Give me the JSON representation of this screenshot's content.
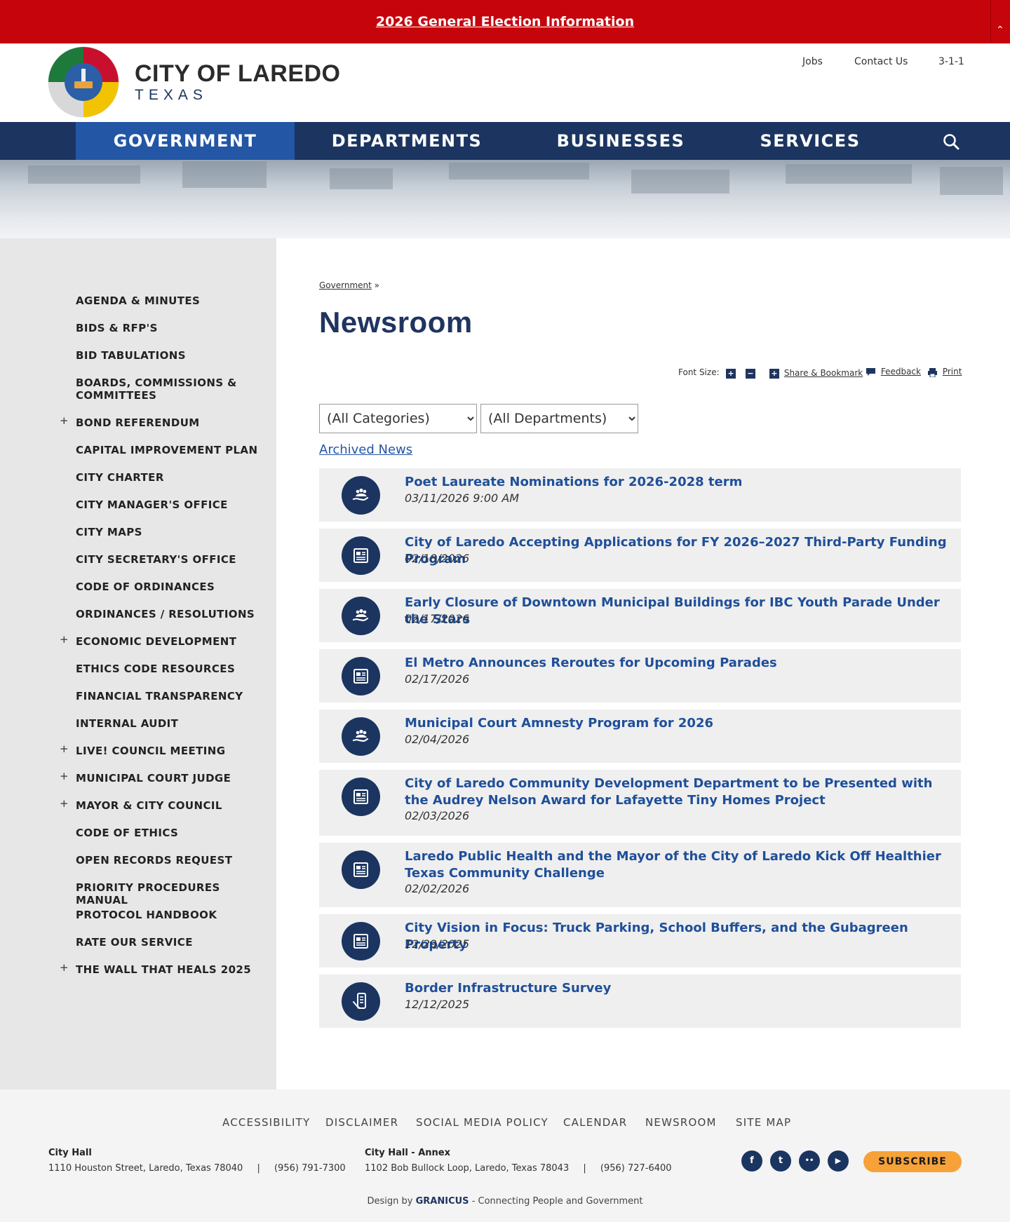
{
  "alert": {
    "text": "2026 General Election Information",
    "top_icon": "double-chevron-up-icon"
  },
  "brand": {
    "title": "CITY OF LAREDO",
    "subtitle": "TEXAS",
    "seal": "city-seal"
  },
  "utility": [
    "Jobs",
    "Contact Us",
    "3-1-1"
  ],
  "nav": {
    "items": [
      "GOVERNMENT",
      "DEPARTMENTS",
      "BUSINESSES",
      "SERVICES"
    ],
    "active": "GOVERNMENT",
    "search_icon": "search-icon"
  },
  "sidebar": {
    "items": [
      {
        "label": "AGENDA & MINUTES",
        "expand": ""
      },
      {
        "label": "BIDS & RFP'S",
        "expand": ""
      },
      {
        "label": "BID TABULATIONS",
        "expand": ""
      },
      {
        "label": "BOARDS, COMMISSIONS & COMMITTEES",
        "expand": ""
      },
      {
        "label": "BOND REFERENDUM",
        "expand": "+"
      },
      {
        "label": "CAPITAL IMPROVEMENT PLAN",
        "expand": ""
      },
      {
        "label": "CITY CHARTER",
        "expand": ""
      },
      {
        "label": "CITY MANAGER'S OFFICE",
        "expand": ""
      },
      {
        "label": "CITY MAPS",
        "expand": ""
      },
      {
        "label": "CITY SECRETARY'S OFFICE",
        "expand": ""
      },
      {
        "label": "CODE OF ORDINANCES",
        "expand": ""
      },
      {
        "label": "ORDINANCES / RESOLUTIONS",
        "expand": ""
      },
      {
        "label": "ECONOMIC DEVELOPMENT",
        "expand": "+"
      },
      {
        "label": "ETHICS CODE RESOURCES",
        "expand": ""
      },
      {
        "label": "FINANCIAL TRANSPARENCY",
        "expand": ""
      },
      {
        "label": "INTERNAL AUDIT",
        "expand": ""
      },
      {
        "label": "LIVE! COUNCIL MEETING",
        "expand": "+"
      },
      {
        "label": "MUNICIPAL COURT JUDGE",
        "expand": "+"
      },
      {
        "label": "MAYOR & CITY COUNCIL",
        "expand": "+"
      },
      {
        "label": "CODE OF ETHICS",
        "expand": ""
      },
      {
        "label": "OPEN RECORDS REQUEST",
        "expand": ""
      },
      {
        "label": "PRIORITY PROCEDURES MANUAL",
        "expand": ""
      },
      {
        "label": "PROTOCOL HANDBOOK",
        "expand": ""
      },
      {
        "label": "RATE OUR SERVICE",
        "expand": ""
      },
      {
        "label": "THE WALL THAT HEALS 2025",
        "expand": "+"
      }
    ]
  },
  "breadcrumb": {
    "link": "Government",
    "sep": "»"
  },
  "page_title": "Newsroom",
  "tools": {
    "font_size_label": "Font Size:",
    "increase": "+",
    "decrease": "−",
    "share_icon": "+",
    "share": "Share & Bookmark",
    "feedback": "Feedback",
    "print": "Print"
  },
  "filters": {
    "categories": "(All Categories)",
    "departments": "(All Departments)"
  },
  "archived_link": "Archived News",
  "news": [
    {
      "title": "Poet Laureate Nominations for 2026-2028 term",
      "date": "03/11/2026 9:00 AM",
      "icon": "community-hand-icon"
    },
    {
      "title": "City of Laredo Accepting Applications for FY 2026–2027 Third-Party Funding Program",
      "date": "02/18/2026",
      "icon": "newspaper-icon"
    },
    {
      "title": "Early Closure of Downtown Municipal Buildings for IBC Youth Parade Under the Stars",
      "date": "02/17/2026",
      "icon": "community-hand-icon"
    },
    {
      "title": "El Metro Announces Reroutes for Upcoming Parades",
      "date": "02/17/2026",
      "icon": "newspaper-icon"
    },
    {
      "title": "Municipal Court Amnesty Program for 2026",
      "date": "02/04/2026",
      "icon": "community-hand-icon"
    },
    {
      "title": "City of Laredo Community Development Department to be Presented with the Audrey Nelson Award for Lafayette Tiny Homes Project",
      "date": "02/03/2026",
      "icon": "newspaper-icon"
    },
    {
      "title": "Laredo Public Health and the Mayor of the City of Laredo Kick Off Healthier Texas Community Challenge",
      "date": "02/02/2026",
      "icon": "newspaper-icon"
    },
    {
      "title": "City Vision in Focus: Truck Parking, School Buffers, and the Gubagreen Property",
      "date": "12/29/2025",
      "icon": "newspaper-icon"
    },
    {
      "title": "Border Infrastructure Survey",
      "date": "12/12/2025",
      "icon": "mobile-survey-icon"
    }
  ],
  "footer": {
    "links": [
      "ACCESSIBILITY",
      "DISCLAIMER",
      "SOCIAL MEDIA POLICY",
      "CALENDAR",
      "NEWSROOM",
      "SITE MAP"
    ],
    "city_hall": {
      "title": "City Hall",
      "address": "1110 Houston Street, Laredo, Texas 78040",
      "sep": "|",
      "phone": "(956) 791-7300"
    },
    "annex": {
      "title": "City Hall - Annex",
      "address": "1102 Bob Bullock Loop, Laredo, Texas 78043",
      "sep": "|",
      "phone": "(956) 727-6400"
    },
    "social": [
      {
        "name": "facebook-icon",
        "glyph": "f"
      },
      {
        "name": "twitter-icon",
        "glyph": "t"
      },
      {
        "name": "flickr-icon",
        "glyph": "••"
      },
      {
        "name": "youtube-icon",
        "glyph": "▶"
      }
    ],
    "subscribe": "SUBSCRIBE",
    "credit_prefix": "Design by",
    "credit_brand": "GRANICUS",
    "credit_suffix": "- Connecting People and Government"
  },
  "colors": {
    "alert_red": "#c6040c",
    "navy": "#1b3560",
    "active_blue": "#2356a5",
    "link_blue": "#1f4f99",
    "subscribe_orange": "#f7a239",
    "sidebar_gray": "#e7e7e8"
  }
}
